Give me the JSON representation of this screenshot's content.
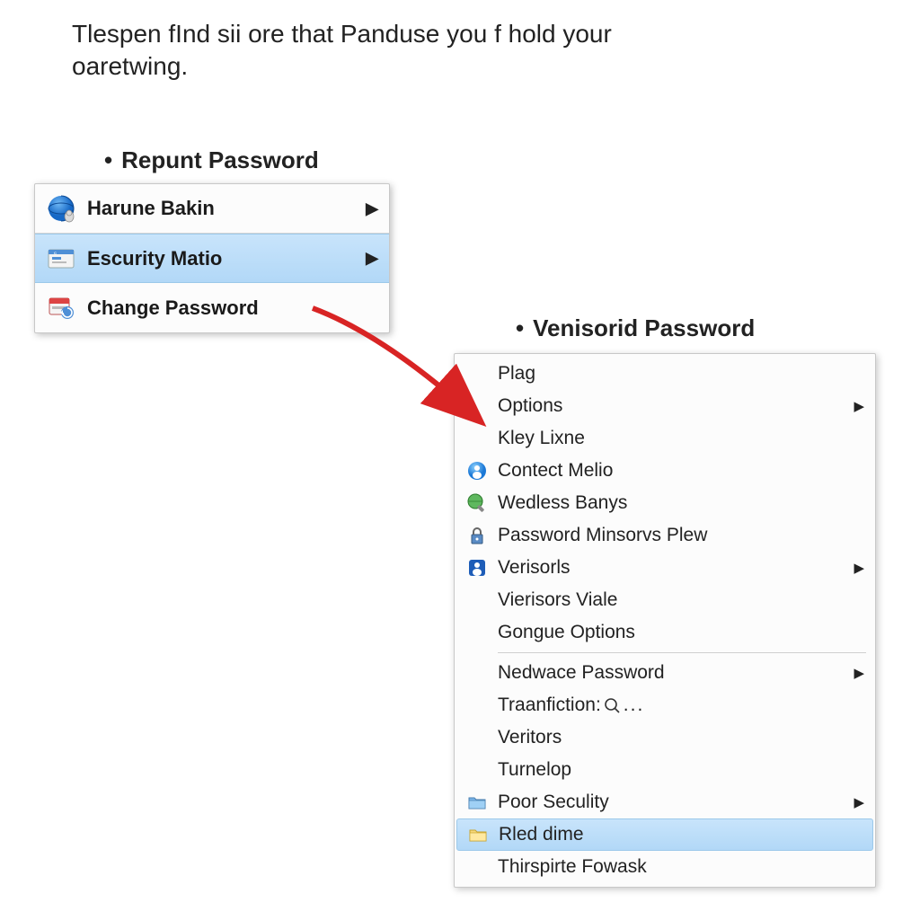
{
  "heading": "Tlespen fInd sii ore that Panduse you f hold your oaretwing.",
  "labels": {
    "menu1": "Repunt Password",
    "menu2": "Venisorid Password"
  },
  "menu1": {
    "items": [
      {
        "label": "Harune Bakin",
        "icon": "globe-person-icon",
        "has_submenu": true,
        "selected": false
      },
      {
        "label": "Escurity Matio",
        "icon": "security-card-icon",
        "has_submenu": true,
        "selected": true
      },
      {
        "label": "Change Password",
        "icon": "change-password-icon",
        "has_submenu": false,
        "selected": false
      }
    ]
  },
  "menu2": {
    "items": [
      {
        "label": "Plag",
        "icon": "",
        "has_submenu": false
      },
      {
        "label": "Options",
        "icon": "",
        "has_submenu": true
      },
      {
        "label": "Kley Lixne",
        "icon": "",
        "has_submenu": false
      },
      {
        "label": "Contect Melio",
        "icon": "info-person-icon",
        "has_submenu": false
      },
      {
        "label": "Wedless Banys",
        "icon": "globe-wrench-icon",
        "has_submenu": false
      },
      {
        "label": "Password Minsorvs Plew",
        "icon": "lock-icon",
        "has_submenu": false
      },
      {
        "label": "Verisorls",
        "icon": "verisorls-icon",
        "has_submenu": true
      },
      {
        "label": "Vierisors Viale",
        "icon": "",
        "has_submenu": false
      },
      {
        "label": "Gongue Options",
        "icon": "",
        "has_submenu": false
      },
      {
        "separator": true
      },
      {
        "label": "Nedwace Password",
        "icon": "",
        "has_submenu": true
      },
      {
        "label": "Traanfiction:",
        "icon": "",
        "suffix_icon": "search-ellipsis-icon",
        "has_submenu": false
      },
      {
        "label": "Veritors",
        "icon": "",
        "has_submenu": false
      },
      {
        "label": "Turnelop",
        "icon": "",
        "has_submenu": false
      },
      {
        "label": "Poor Seculity",
        "icon": "folder-blue-icon",
        "has_submenu": true
      },
      {
        "label": "Rled dime",
        "icon": "folder-yellow-icon",
        "has_submenu": false,
        "selected": true
      },
      {
        "label": "Thirspirte Fowask",
        "icon": "",
        "has_submenu": false
      }
    ]
  }
}
